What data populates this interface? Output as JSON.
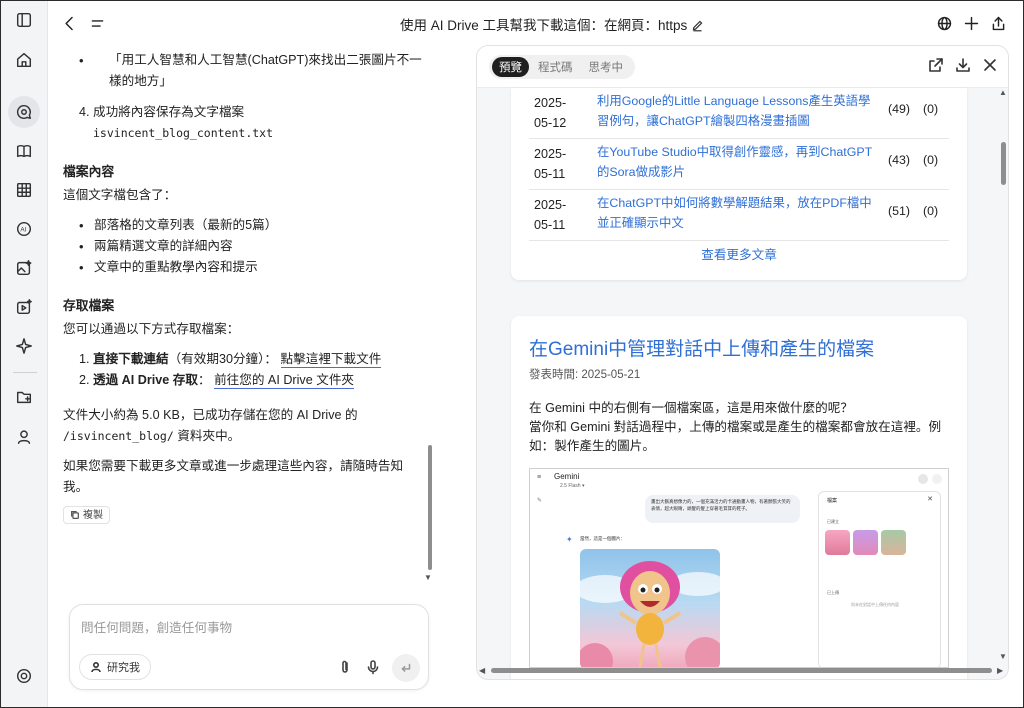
{
  "window": {
    "title": "使用 AI Drive 工具幫我下載這個：在網頁：https"
  },
  "rail": {
    "items": [
      "panel-icon",
      "home-icon",
      "chat-search-icon",
      "book-icon",
      "grid-icon",
      "ai-icon",
      "image-spark-icon",
      "video-spark-icon",
      "sparkle-icon",
      "folder-icon",
      "user-icon",
      "settings-icon"
    ]
  },
  "chat": {
    "bullet_top": "「用工人智慧和人工智慧(ChatGPT)來找出二張圖片不一樣的地方」",
    "step4_num": "4.",
    "step4_text": "成功將內容保存為文字檔案",
    "step4_file": "isvincent_blog_content.txt",
    "h_file": "檔案內容",
    "file_intro": "這個文字檔包含了：",
    "file_items": [
      "部落格的文章列表（最新的5篇）",
      "兩篇精選文章的詳細內容",
      "文章中的重點教學內容和提示"
    ],
    "h_access": "存取檔案",
    "access_intro": "您可以通過以下方式存取檔案：",
    "access_1_num": "1.",
    "access_1_bold": "直接下載連結",
    "access_1_note": "（有效期30分鐘）：",
    "access_1_link": "點擊這裡下載文件",
    "access_2_num": "2.",
    "access_2_bold": "透過 AI Drive 存取",
    "access_2_sep": "：",
    "access_2_link": "前往您的 AI Drive 文件夾",
    "size_line_a": "文件大小約為 5.0 KB，已成功存儲在您的 AI Drive 的",
    "size_path": "/isvincent_blog/",
    "size_line_b": "資料夾中。",
    "closing": "如果您需要下載更多文章或進一步處理這些內容，請隨時告知我。",
    "copy_label": "複製"
  },
  "composer": {
    "placeholder": "問任何問題，創造任何事物",
    "research_label": "研究我"
  },
  "preview": {
    "tabs": [
      {
        "label": "預覽",
        "active": true
      },
      {
        "label": "程式碼",
        "active": false
      },
      {
        "label": "思考中",
        "active": false
      }
    ],
    "rows": [
      {
        "date": "2025-05-12",
        "title": "利用Google的Little Language Lessons產生英語學習例句，讓ChatGPT繪製四格漫畫插圖",
        "views": "(49)",
        "comments": "(0)"
      },
      {
        "date": "2025-05-11",
        "title": "在YouTube Studio中取得創作靈感，再到ChatGPT的Sora做成影片",
        "views": "(43)",
        "comments": "(0)"
      },
      {
        "date": "2025-05-11",
        "title": "在ChatGPT中如何將數學解題結果，放在PDF檔中並正確顯示中文",
        "views": "(51)",
        "comments": "(0)"
      }
    ],
    "more_link": "查看更多文章",
    "article": {
      "title": "在Gemini中管理對話中上傳和產生的檔案",
      "date": "發表時間: 2025-05-21",
      "body_1": "在 Gemini 中的右側有一個檔案區，這是用來做什麼的呢？",
      "body_2": "當你和 Gemini 對話過程中，上傳的檔案或是產生的檔案都會放在這裡。例如：製作產生的圖片。"
    },
    "inner_shot": {
      "app": "Gemini",
      "model": "2.5 Flash ▾",
      "prompt": "畫出大鬍真想像力的，一個充滿活力的卡通動畫人物，有著顏張大笑的表情，超大眼睛，頭髮的髮上穿著毛茸茸的鞋子。",
      "reply": "當然，這是一個圖片：",
      "panel_title": "檔案",
      "panel_close": "✕",
      "panel_label_1": "已建立",
      "panel_label_2": "已上傳",
      "panel_empty": "尚未在對話中上傳任何內容"
    }
  }
}
